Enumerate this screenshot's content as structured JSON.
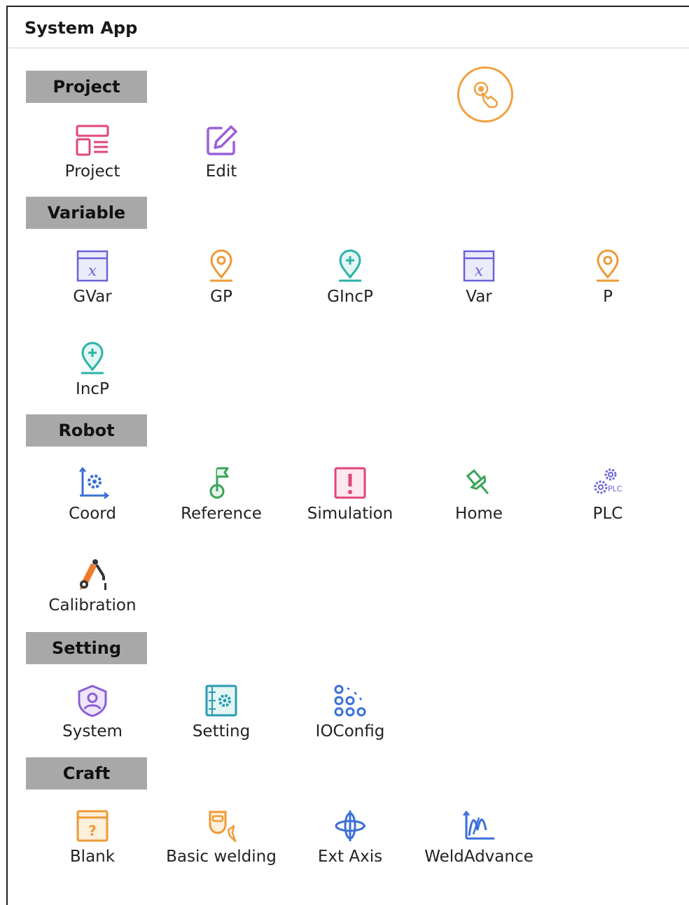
{
  "window": {
    "title": "System App"
  },
  "sections": {
    "project": {
      "title": "Project",
      "items": [
        {
          "label": "Project",
          "icon": "project-layout-icon"
        },
        {
          "label": "Edit",
          "icon": "edit-icon"
        }
      ]
    },
    "variable": {
      "title": "Variable",
      "items": [
        {
          "label": "GVar",
          "icon": "variable-x-icon"
        },
        {
          "label": "GP",
          "icon": "location-pin-icon"
        },
        {
          "label": "GIncP",
          "icon": "location-pin-plus-icon"
        },
        {
          "label": "Var",
          "icon": "variable-x-icon"
        },
        {
          "label": "P",
          "icon": "location-pin-icon"
        },
        {
          "label": "IncP",
          "icon": "location-pin-plus-icon"
        }
      ]
    },
    "robot": {
      "title": "Robot",
      "items": [
        {
          "label": "Coord",
          "icon": "coordinate-gear-icon"
        },
        {
          "label": "Reference",
          "icon": "reference-flag-icon"
        },
        {
          "label": "Simulation",
          "icon": "simulation-alert-icon"
        },
        {
          "label": "Home",
          "icon": "home-pin-icon"
        },
        {
          "label": "PLC",
          "icon": "plc-gears-icon"
        },
        {
          "label": "Calibration",
          "icon": "robot-arm-icon"
        }
      ]
    },
    "setting": {
      "title": "Setting",
      "items": [
        {
          "label": "System",
          "icon": "system-user-shield-icon"
        },
        {
          "label": "Setting",
          "icon": "settings-panel-icon"
        },
        {
          "label": "IOConfig",
          "icon": "io-config-icon"
        }
      ]
    },
    "craft": {
      "title": "Craft",
      "items": [
        {
          "label": "Blank",
          "icon": "blank-question-icon"
        },
        {
          "label": "Basic welding",
          "icon": "welding-mask-icon"
        },
        {
          "label": "Ext Axis",
          "icon": "ext-axis-icon"
        },
        {
          "label": "WeldAdvance",
          "icon": "weld-advance-icon"
        }
      ]
    }
  },
  "colors": {
    "header_bg": "#a8a8a8",
    "accent_orange": "#f0a040",
    "pink": "#e0457b",
    "purple": "#8a5fd8",
    "teal": "#2ab3a8",
    "blue": "#3a6fd8",
    "green": "#3aa35a"
  }
}
